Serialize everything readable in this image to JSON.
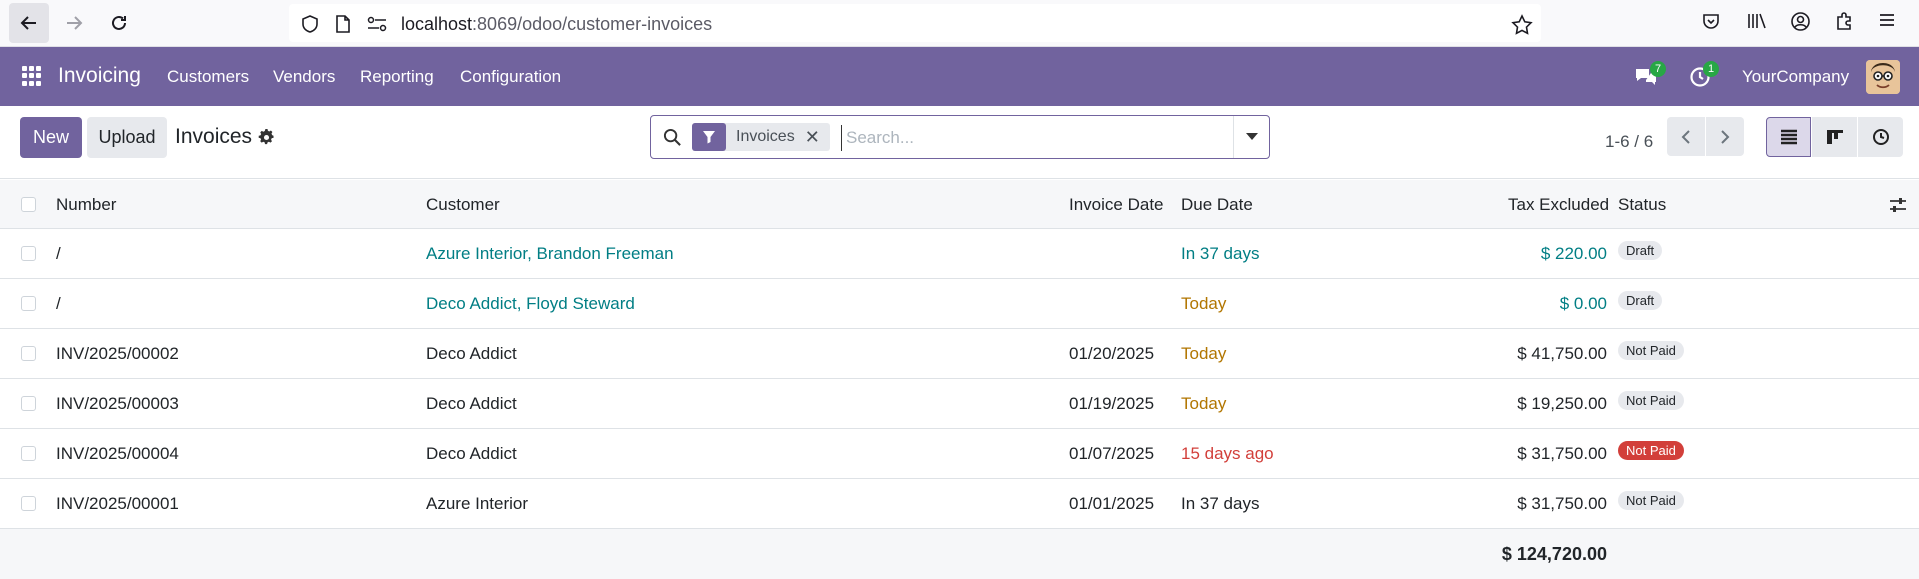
{
  "browser": {
    "url_host": "localhost",
    "url_path": ":8069/odoo/customer-invoices"
  },
  "navbar": {
    "brand": "Invoicing",
    "menus": [
      "Customers",
      "Vendors",
      "Reporting",
      "Configuration"
    ],
    "messages_count": "7",
    "activities_count": "1",
    "company": "YourCompany"
  },
  "control": {
    "new_label": "New",
    "upload_label": "Upload",
    "title": "Invoices",
    "facet_label": "Invoices",
    "search_placeholder": "Search...",
    "pager": "1-6 / 6"
  },
  "table": {
    "columns": {
      "number": "Number",
      "customer": "Customer",
      "invoice_date": "Invoice Date",
      "due_date": "Due Date",
      "tax_excluded": "Tax Excluded",
      "status": "Status"
    },
    "rows": [
      {
        "number": "/",
        "customer": "Azure Interior, Brandon Freeman",
        "invoice_date": "",
        "due_date": "In 37 days",
        "amount": "$ 220.00",
        "status": "Draft"
      },
      {
        "number": "/",
        "customer": "Deco Addict, Floyd Steward",
        "invoice_date": "",
        "due_date": "Today",
        "amount": "$ 0.00",
        "status": "Draft"
      },
      {
        "number": "INV/2025/00002",
        "customer": "Deco Addict",
        "invoice_date": "01/20/2025",
        "due_date": "Today",
        "amount": "$ 41,750.00",
        "status": "Not Paid"
      },
      {
        "number": "INV/2025/00003",
        "customer": "Deco Addict",
        "invoice_date": "01/19/2025",
        "due_date": "Today",
        "amount": "$ 19,250.00",
        "status": "Not Paid"
      },
      {
        "number": "INV/2025/00004",
        "customer": "Deco Addict",
        "invoice_date": "01/07/2025",
        "due_date": "15 days ago",
        "amount": "$ 31,750.00",
        "status": "Not Paid"
      },
      {
        "number": "INV/2025/00001",
        "customer": "Azure Interior",
        "invoice_date": "01/01/2025",
        "due_date": "In 37 days",
        "amount": "$ 31,750.00",
        "status": "Not Paid"
      }
    ],
    "total": "$ 124,720.00"
  },
  "colors": {
    "brand": "#71639e",
    "link": "#017e84",
    "warning": "#b27600",
    "danger": "#d23f3a"
  }
}
